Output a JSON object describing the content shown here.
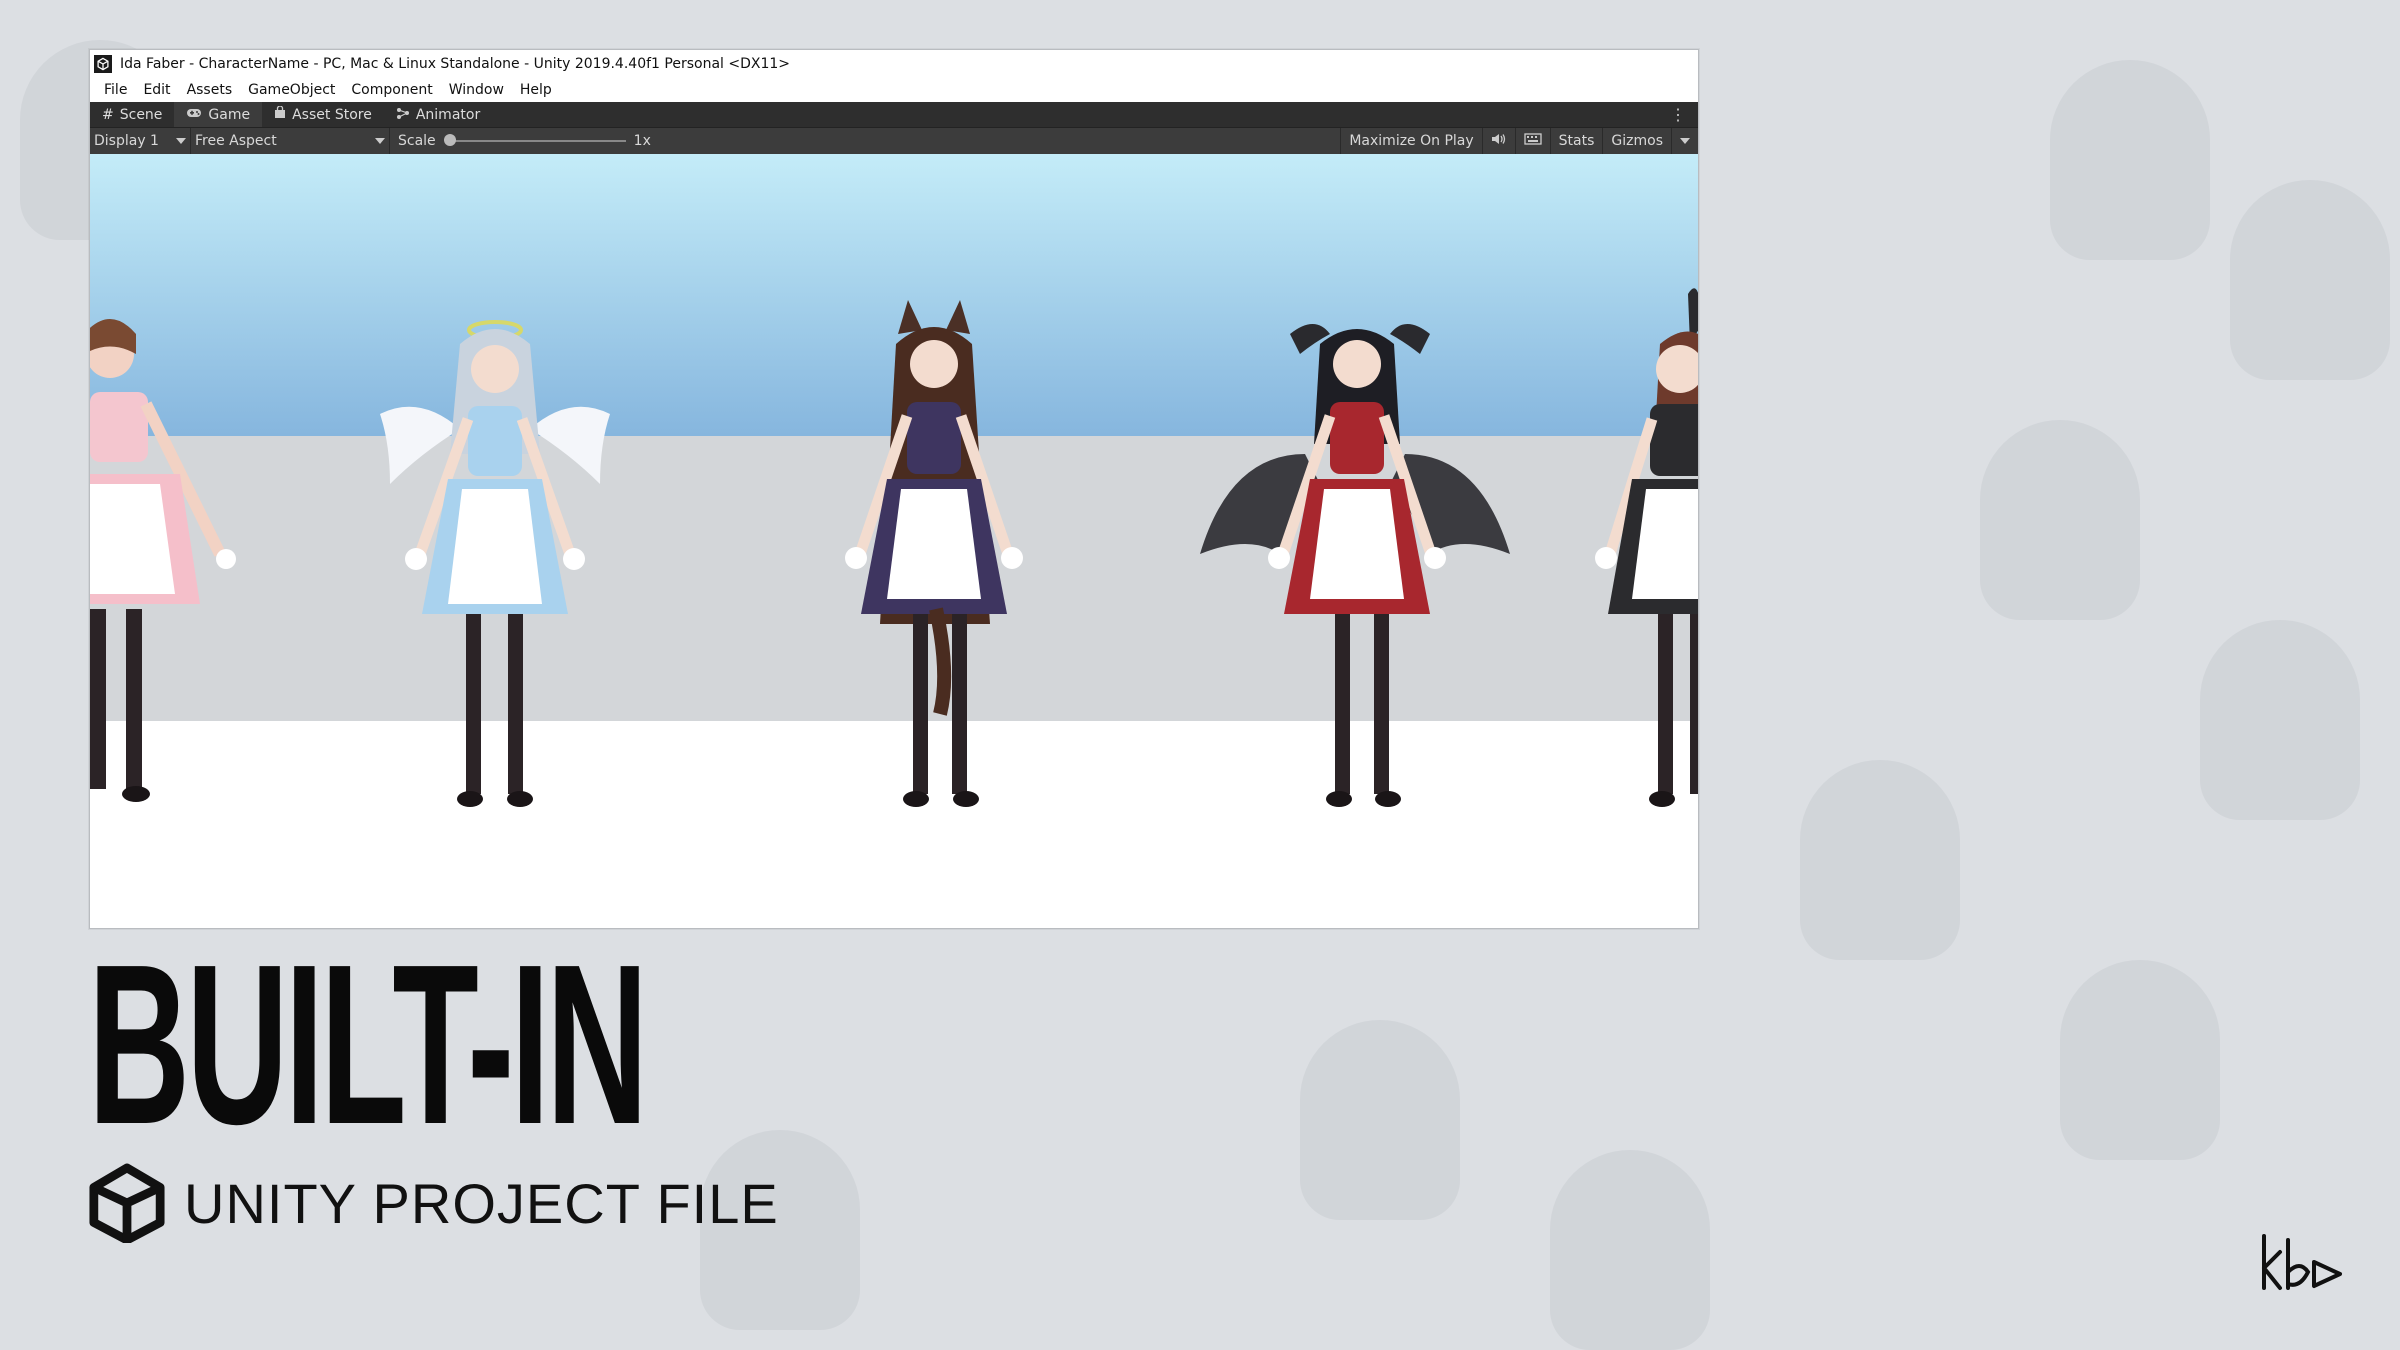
{
  "window": {
    "title": "Ida Faber - CharacterName - PC, Mac & Linux Standalone - Unity 2019.4.40f1 Personal <DX11>"
  },
  "menu": [
    "File",
    "Edit",
    "Assets",
    "GameObject",
    "Component",
    "Window",
    "Help"
  ],
  "tabs": [
    {
      "label": "Scene",
      "icon": "grid-icon",
      "active": false
    },
    {
      "label": "Game",
      "icon": "gamepad-icon",
      "active": true
    },
    {
      "label": "Asset Store",
      "icon": "bag-icon",
      "active": false
    },
    {
      "label": "Animator",
      "icon": "animator-icon",
      "active": false
    }
  ],
  "toolbar": {
    "display": "Display 1",
    "aspect": "Free Aspect",
    "scale_label": "Scale",
    "scale_value": "1x",
    "maximize": "Maximize On Play",
    "stats": "Stats",
    "gizmos": "Gizmos"
  },
  "viewport": {
    "characters": [
      "pink-maid",
      "angel-maid",
      "cat-maid",
      "devil-maid",
      "bunny-maid"
    ],
    "colors": {
      "sky_top": "#bfe9f7",
      "sky_bottom": "#7fb2dc",
      "wall": "#d4d7da",
      "floor": "#ffffff"
    }
  },
  "headline": "BUILT-IN",
  "subline": "UNITY PROJECT FILE",
  "colors": {
    "background": "#dcdfe3",
    "editor_dark": "#3c3c3c",
    "tab_bar": "#2e2e2e"
  }
}
